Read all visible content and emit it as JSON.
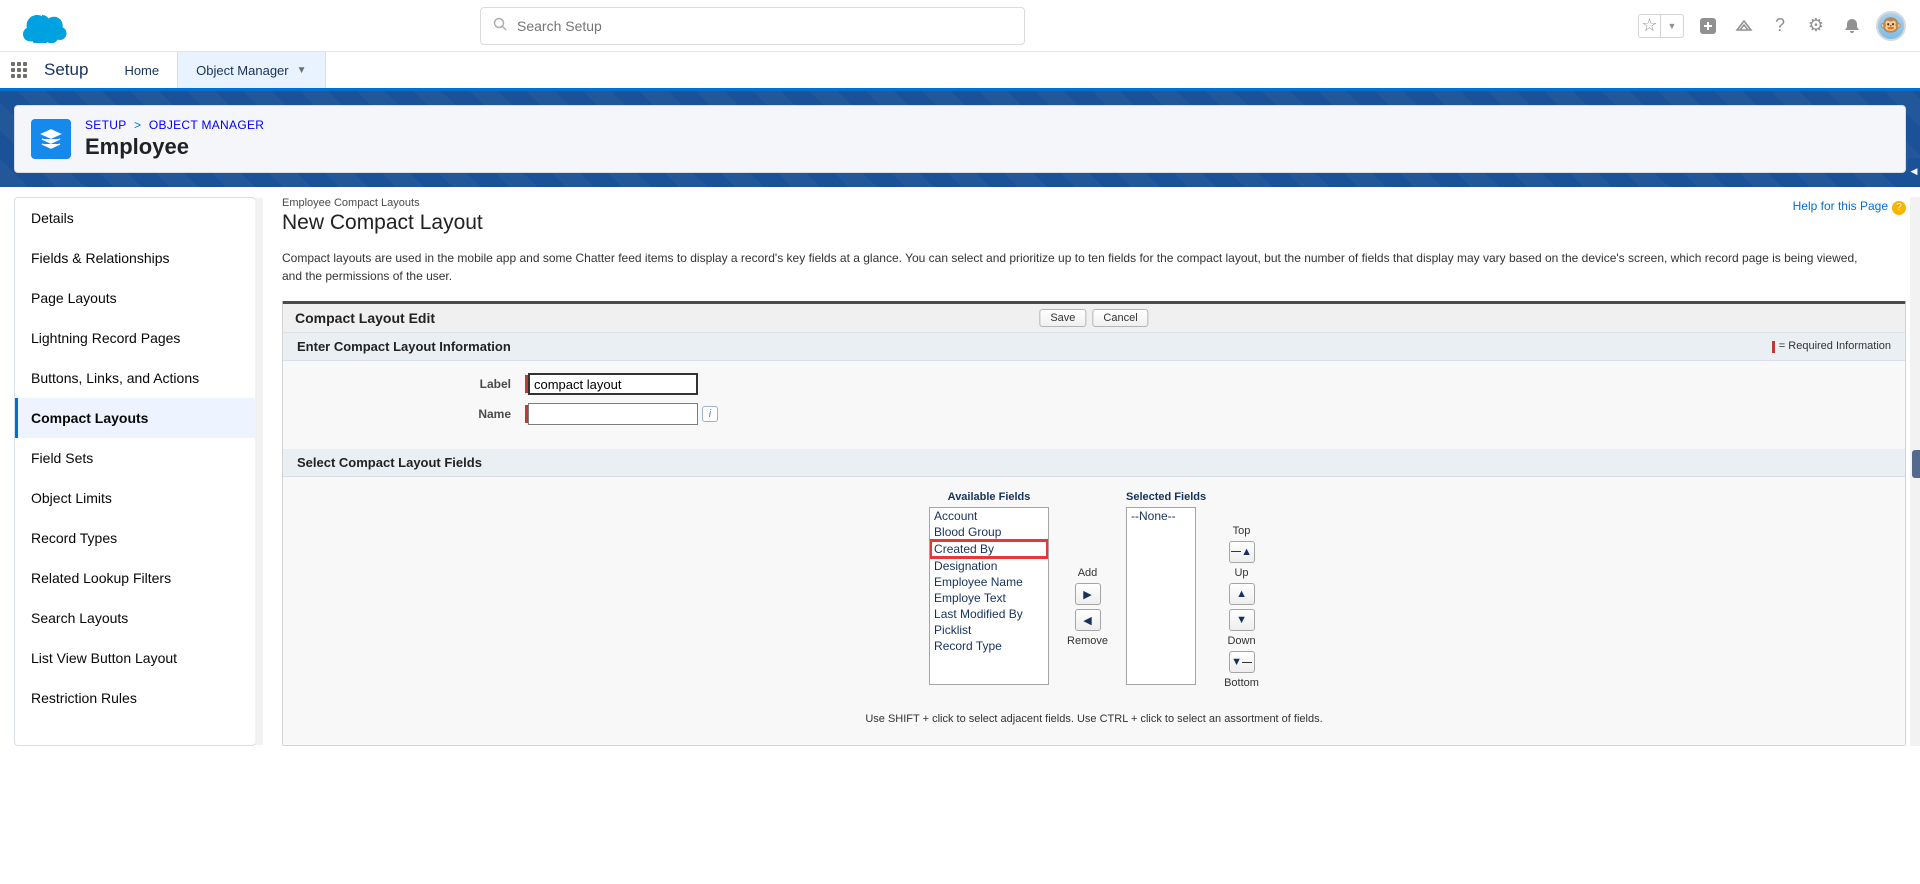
{
  "search": {
    "placeholder": "Search Setup"
  },
  "nav": {
    "appName": "Setup",
    "home": "Home",
    "objectManager": "Object Manager"
  },
  "breadcrumb": {
    "setup": "SETUP",
    "objectManager": "OBJECT MANAGER",
    "title": "Employee"
  },
  "sidebar": {
    "items": [
      "Details",
      "Fields & Relationships",
      "Page Layouts",
      "Lightning Record Pages",
      "Buttons, Links, and Actions",
      "Compact Layouts",
      "Field Sets",
      "Object Limits",
      "Record Types",
      "Related Lookup Filters",
      "Search Layouts",
      "List View Button Layout",
      "Restriction Rules"
    ],
    "activeIndex": 5
  },
  "help": {
    "label": "Help for this Page"
  },
  "page": {
    "smallTitle": "Employee Compact Layouts",
    "bigTitle": "New Compact Layout",
    "intro": "Compact layouts are used in the mobile app and some Chatter feed items to display a record's key fields at a glance. You can select and prioritize up to ten fields for the compact layout, but the number of fields that display may vary based on the device's screen, which record page is being viewed, and the permissions of the user."
  },
  "panel": {
    "editTitle": "Compact Layout Edit",
    "save": "Save",
    "cancel": "Cancel",
    "infoHeader": "Enter Compact Layout Information",
    "requiredInfo": "= Required Information",
    "labelLabel": "Label",
    "labelValue": "compact layout",
    "nameLabel": "Name",
    "nameValue": "",
    "fieldsHeader": "Select Compact Layout Fields"
  },
  "dual": {
    "availableTitle": "Available Fields",
    "selectedTitle": "Selected Fields",
    "available": [
      "Account",
      "Blood Group",
      "Created By",
      "Designation",
      "Employee Name",
      "Employe Text",
      "Last Modified By",
      "Picklist",
      "Record Type"
    ],
    "selected": [
      "--None--"
    ],
    "highlightedIndex": 2,
    "add": "Add",
    "remove": "Remove",
    "top": "Top",
    "up": "Up",
    "down": "Down",
    "bottom": "Bottom",
    "hint": "Use SHIFT + click to select adjacent fields. Use CTRL + click to select an assortment of fields."
  }
}
